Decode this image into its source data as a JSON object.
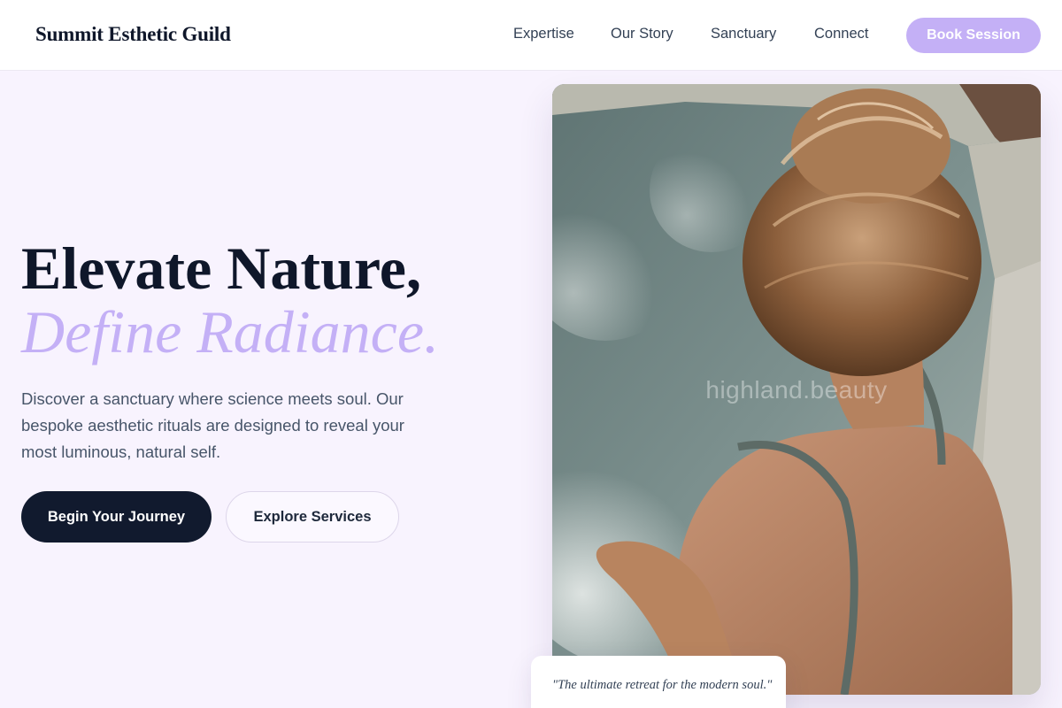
{
  "header": {
    "brand": "Summit Esthetic Guild",
    "nav": [
      "Expertise",
      "Our Story",
      "Sanctuary",
      "Connect"
    ],
    "cta_label": "Book Session"
  },
  "hero": {
    "title_line1": "Elevate Nature,",
    "title_line2": "Define Radiance.",
    "description": "Discover a sanctuary where science meets soul. Our bespoke aesthetic rituals are designed to reveal your most luminous, natural self.",
    "primary_button": "Begin Your Journey",
    "secondary_button": "Explore Services"
  },
  "image": {
    "watermark": "highland.beauty"
  },
  "quote": {
    "text": "\"The ultimate retreat for the modern soul.\""
  },
  "colors": {
    "accent": "#c4b0f6",
    "dark": "#111a2e",
    "background": "#f8f3fe"
  }
}
